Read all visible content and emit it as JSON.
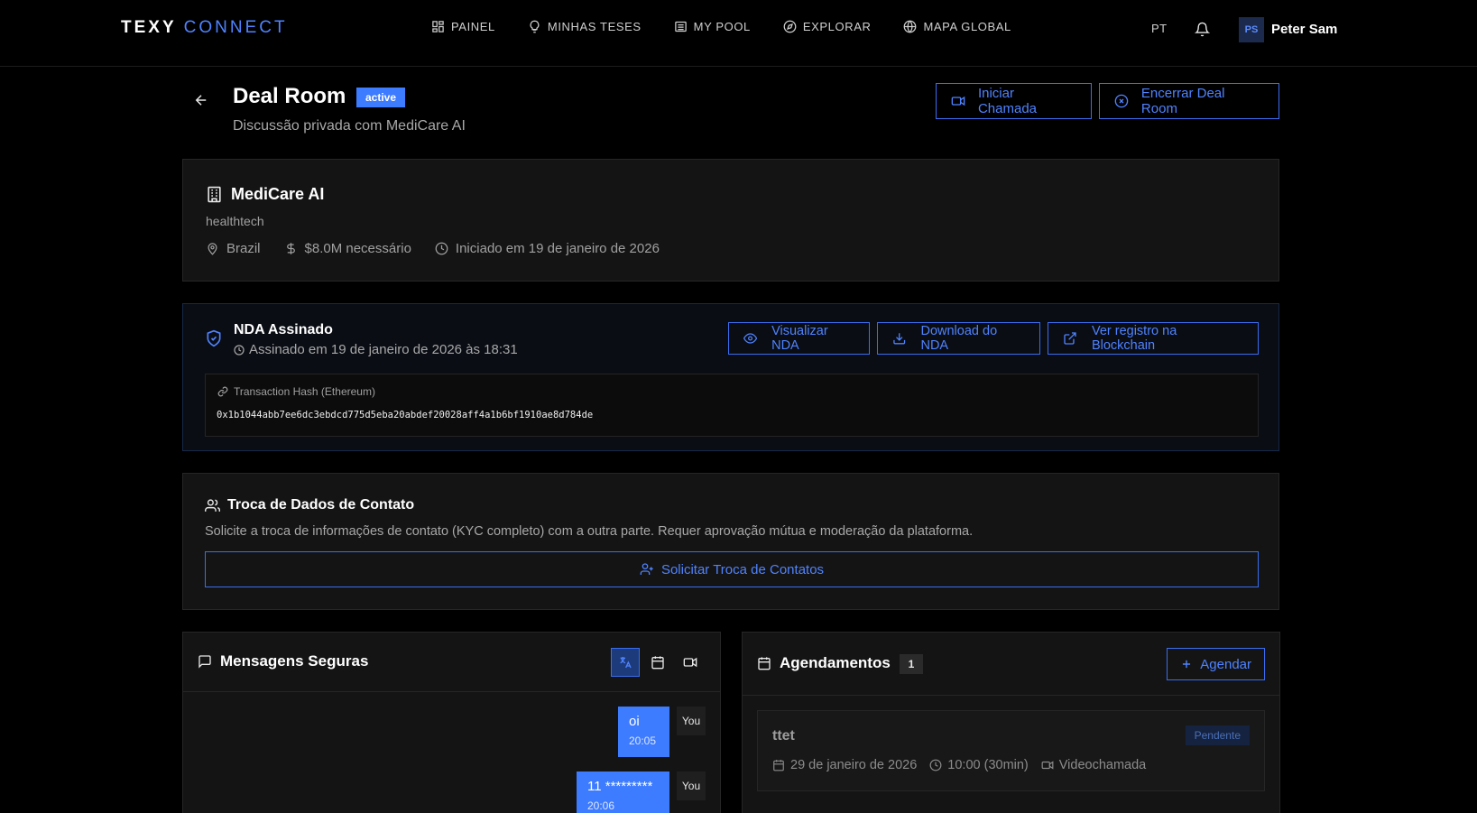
{
  "brand": {
    "part1": "TEXY",
    "part2": "CONNECT"
  },
  "nav": {
    "items": [
      {
        "label": "PAINEL",
        "icon": "grid-icon"
      },
      {
        "label": "MINHAS TESES",
        "icon": "lightbulb-icon"
      },
      {
        "label": "MY POOL",
        "icon": "archive-icon"
      },
      {
        "label": "EXPLORAR",
        "icon": "compass-icon"
      },
      {
        "label": "MAPA GLOBAL",
        "icon": "globe-icon"
      }
    ],
    "language": "PT",
    "user": {
      "initials": "PS",
      "name": "Peter Sam"
    }
  },
  "header": {
    "title": "Deal Room",
    "status": "active",
    "subtitle": "Discussão privada com MediCare AI",
    "call_button": "Iniciar Chamada",
    "close_button": "Encerrar Deal Room"
  },
  "company": {
    "name": "MediCare AI",
    "sector": "healthtech",
    "country": "Brazil",
    "funding": "$8.0M necessário",
    "started": "Iniciado em 19 de janeiro de 2026"
  },
  "nda": {
    "title": "NDA Assinado",
    "signed_at": "Assinado em 19 de janeiro de 2026 às 18:31",
    "view_button": "Visualizar NDA",
    "download_button": "Download do NDA",
    "blockchain_button": "Ver registro na Blockchain",
    "hash_label": "Transaction Hash (Ethereum)",
    "hash_value": "0x1b1044abb7ee6dc3ebdcd775d5eba20abdef20028aff4a1b6bf1910ae8d784de"
  },
  "kyc": {
    "title": "Troca de Dados de Contato",
    "description": "Solicite a troca de informações de contato (KYC completo) com a outra parte. Requer aprovação mútua e moderação da plataforma.",
    "button": "Solicitar Troca de Contatos"
  },
  "messages": {
    "title": "Mensagens Seguras",
    "items": [
      {
        "text": "oi",
        "time": "20:05",
        "sender": "You"
      },
      {
        "text": "11 *********",
        "time": "20:06",
        "sender": "You"
      }
    ]
  },
  "schedule": {
    "title": "Agendamentos",
    "count": "1",
    "button": "Agendar",
    "items": [
      {
        "title": "ttet",
        "status": "Pendente",
        "date": "29 de janeiro de 2026",
        "time": "10:00 (30min)",
        "type": "Videochamada"
      }
    ]
  },
  "colors": {
    "accent": "#3d7bff",
    "background": "#000000",
    "card": "#141414"
  }
}
